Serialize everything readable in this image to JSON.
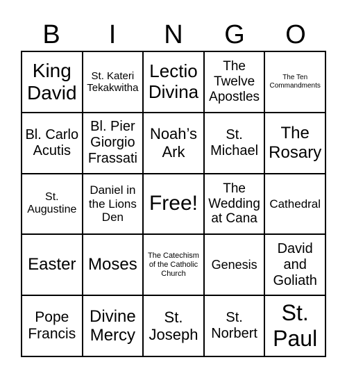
{
  "header": [
    "B",
    "I",
    "N",
    "G",
    "O"
  ],
  "cells": [
    "King David",
    "St. Kateri Tekakwitha",
    "Lectio Divina",
    "The Twelve Apostles",
    "The Ten Commandments",
    "Bl. Carlo Acutis",
    "Bl. Pier Giorgio Frassati",
    "Noah’s Ark",
    "St. Michael",
    "The Rosary",
    "St. Augustine",
    "Daniel in the Lions Den",
    "Free!",
    "The Wedding at Cana",
    "Cathedral",
    "Easter",
    "Moses",
    "The Catechism of the Catholic Church",
    "Genesis",
    "David and Goliath",
    "Pope Francis",
    "Divine Mercy",
    "St. Joseph",
    "St. Norbert",
    "St. Paul"
  ]
}
